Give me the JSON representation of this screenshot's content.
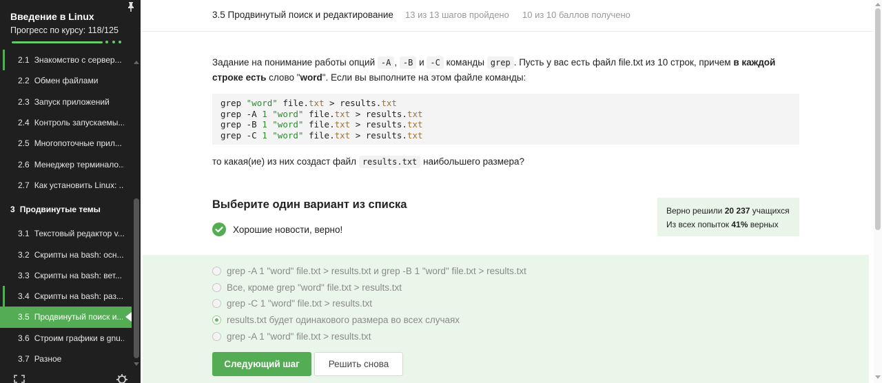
{
  "sidebar": {
    "course_title": "Введение в Linux",
    "progress_label": "Прогресс по курсу:",
    "progress_value": "118/125",
    "progress_fraction": 0.944,
    "items": [
      {
        "num": "2.1",
        "label": "Знакомство с сервер..."
      },
      {
        "num": "2.2",
        "label": "Обмен файлами"
      },
      {
        "num": "2.3",
        "label": "Запуск приложений"
      },
      {
        "num": "2.4",
        "label": "Контроль запускаемы..."
      },
      {
        "num": "2.5",
        "label": "Многопоточные прил..."
      },
      {
        "num": "2.6",
        "label": "Менеджер терминало..."
      },
      {
        "num": "2.7",
        "label": "Как установить Linux: ..."
      }
    ],
    "section": {
      "num": "3",
      "label": "Продвинутые темы"
    },
    "section_items": [
      {
        "num": "3.1",
        "label": "Текстовый редактор v..."
      },
      {
        "num": "3.2",
        "label": "Скрипты на bash: осн..."
      },
      {
        "num": "3.3",
        "label": "Скрипты на bash: вет..."
      },
      {
        "num": "3.4",
        "label": "Скрипты на bash: раз..."
      },
      {
        "num": "3.5",
        "label": "Продвинутый поиск и..."
      },
      {
        "num": "3.6",
        "label": "Строим графики в gnu..."
      },
      {
        "num": "3.7",
        "label": "Разное"
      }
    ]
  },
  "header": {
    "lesson_title": "3.5 Продвинутый поиск и редактирование",
    "steps": "13 из 13 шагов пройдено",
    "score": "10 из 10 баллов  получено"
  },
  "task": {
    "p1": "Задание на понимание работы опций",
    "opt_a": "-A",
    "opt_b": "-B",
    "and": "и",
    "opt_c": "-C",
    "p2": "команды",
    "grep": "grep",
    "p3": ". Пусть у вас есть файл file.txt из 10 строк, причем",
    "bold1": "в каждой строке есть",
    "p4": "слово \"",
    "bold2": "word",
    "p5": "\". Если вы выполните на этом файле команды:",
    "question_pre": "то какая(ие) из них создаст файл",
    "question_code": "results.txt",
    "question_post": "наибольшего размера?"
  },
  "choose_title": "Выберите один вариант из списка",
  "feedback": "Хорошие новости, верно!",
  "stats": {
    "line1_pre": "Верно решили",
    "line1_num": "20 237",
    "line1_post": "учащихся",
    "line2_pre": "Из всех попыток",
    "line2_num": "41%",
    "line2_post": "верных"
  },
  "options": [
    {
      "label": "grep -A 1 \"word\" file.txt > results.txt и grep -B 1 \"word\" file.txt > results.txt",
      "checked": false
    },
    {
      "label": "Все, кроме grep \"word\" file.txt > results.txt",
      "checked": false
    },
    {
      "label": "grep -C 1 \"word\" file.txt > results.txt",
      "checked": false
    },
    {
      "label": "results.txt будет одинакового размера во всех случаях",
      "checked": true
    },
    {
      "label": "grep -A 1 \"word\" file.txt > results.txt",
      "checked": false
    }
  ],
  "buttons": {
    "next": "Следующий шаг",
    "retry": "Решить снова"
  },
  "colors": {
    "accent": "#54ad54",
    "sidebar_bg": "#1f1f1f",
    "answer_bg": "#e9f6e9"
  }
}
